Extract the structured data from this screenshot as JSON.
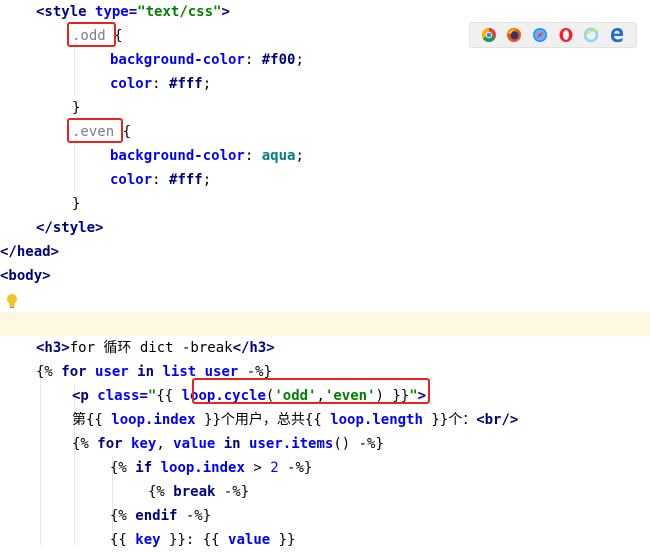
{
  "editor": {
    "lines": [
      {
        "indent": 36,
        "tokens": [
          {
            "t": "<style ",
            "c": "t-tag"
          },
          {
            "t": "type=",
            "c": "t-attr"
          },
          {
            "t": "\"text/css\"",
            "c": "t-str"
          },
          {
            "t": ">",
            "c": "t-tag"
          }
        ]
      },
      {
        "indent": 72,
        "tokens": [
          {
            "t": ".odd",
            "c": "t-sel"
          },
          {
            "t": " {",
            "c": "t-plain"
          }
        ]
      },
      {
        "indent": 110,
        "tokens": [
          {
            "t": "background-color",
            "c": "t-prop"
          },
          {
            "t": ": ",
            "c": "t-plain"
          },
          {
            "t": "#f00",
            "c": "t-val"
          },
          {
            "t": ";",
            "c": "t-plain"
          }
        ]
      },
      {
        "indent": 110,
        "tokens": [
          {
            "t": "color",
            "c": "t-prop"
          },
          {
            "t": ": ",
            "c": "t-plain"
          },
          {
            "t": "#fff",
            "c": "t-val"
          },
          {
            "t": ";",
            "c": "t-plain"
          }
        ]
      },
      {
        "indent": 72,
        "tokens": [
          {
            "t": "}",
            "c": "t-plain"
          }
        ]
      },
      {
        "indent": 72,
        "tokens": [
          {
            "t": ".even",
            "c": "t-sel"
          },
          {
            "t": " {",
            "c": "t-plain"
          }
        ]
      },
      {
        "indent": 110,
        "tokens": [
          {
            "t": "background-color",
            "c": "t-prop"
          },
          {
            "t": ": ",
            "c": "t-plain"
          },
          {
            "t": "aqua",
            "c": "t-cssval"
          },
          {
            "t": ";",
            "c": "t-plain"
          }
        ]
      },
      {
        "indent": 110,
        "tokens": [
          {
            "t": "color",
            "c": "t-prop"
          },
          {
            "t": ": ",
            "c": "t-plain"
          },
          {
            "t": "#fff",
            "c": "t-val"
          },
          {
            "t": ";",
            "c": "t-plain"
          }
        ]
      },
      {
        "indent": 72,
        "tokens": [
          {
            "t": "}",
            "c": "t-plain"
          }
        ]
      },
      {
        "indent": 36,
        "tokens": [
          {
            "t": "</style>",
            "c": "t-tag"
          }
        ]
      },
      {
        "indent": 0,
        "tokens": [
          {
            "t": "</head>",
            "c": "t-tag"
          }
        ]
      },
      {
        "indent": 0,
        "tokens": [
          {
            "t": "<body>",
            "c": "t-tag"
          }
        ]
      },
      {
        "indent": 0,
        "tokens": []
      },
      {
        "indent": 0,
        "current": true,
        "tokens": []
      },
      {
        "indent": 36,
        "tokens": [
          {
            "t": "<h3>",
            "c": "t-tag"
          },
          {
            "t": "for 循环 dict -break",
            "c": "t-text"
          },
          {
            "t": "</h3>",
            "c": "t-tag"
          }
        ]
      },
      {
        "indent": 36,
        "tokens": [
          {
            "t": "{% ",
            "c": "t-tmpl"
          },
          {
            "t": "for ",
            "c": "t-kw"
          },
          {
            "t": "user ",
            "c": "t-var"
          },
          {
            "t": "in ",
            "c": "t-kw"
          },
          {
            "t": "list_user",
            "c": "t-var"
          },
          {
            "t": " -%}",
            "c": "t-tmpl"
          }
        ]
      },
      {
        "indent": 72,
        "tokens": [
          {
            "t": "<p ",
            "c": "t-tag"
          },
          {
            "t": "class=",
            "c": "t-attr"
          },
          {
            "t": "\"",
            "c": "t-str"
          },
          {
            "t": "{{ ",
            "c": "t-tmpl"
          },
          {
            "t": "loop.cycle",
            "c": "t-var"
          },
          {
            "t": "(",
            "c": "t-plain"
          },
          {
            "t": "'odd'",
            "c": "t-str"
          },
          {
            "t": ",",
            "c": "t-plain"
          },
          {
            "t": "'even'",
            "c": "t-str"
          },
          {
            "t": ") ",
            "c": "t-plain"
          },
          {
            "t": "}}",
            "c": "t-tmpl"
          },
          {
            "t": "\"",
            "c": "t-str"
          },
          {
            "t": ">",
            "c": "t-tag"
          }
        ]
      },
      {
        "indent": 72,
        "tokens": [
          {
            "t": "第",
            "c": "t-text"
          },
          {
            "t": "{{ ",
            "c": "t-tmpl"
          },
          {
            "t": "loop.index",
            "c": "t-var"
          },
          {
            "t": " }}",
            "c": "t-tmpl"
          },
          {
            "t": "个用户，总共",
            "c": "t-text"
          },
          {
            "t": "{{ ",
            "c": "t-tmpl"
          },
          {
            "t": "loop.length",
            "c": "t-var"
          },
          {
            "t": " }}",
            "c": "t-tmpl"
          },
          {
            "t": "个：",
            "c": "t-text"
          },
          {
            "t": "<br/>",
            "c": "t-tag"
          }
        ]
      },
      {
        "indent": 72,
        "tokens": [
          {
            "t": "{% ",
            "c": "t-tmpl"
          },
          {
            "t": "for ",
            "c": "t-kw"
          },
          {
            "t": "key",
            "c": "t-var"
          },
          {
            "t": ", ",
            "c": "t-plain"
          },
          {
            "t": "value ",
            "c": "t-var"
          },
          {
            "t": "in ",
            "c": "t-kw"
          },
          {
            "t": "user.items",
            "c": "t-var"
          },
          {
            "t": "() -%}",
            "c": "t-tmpl"
          }
        ]
      },
      {
        "indent": 110,
        "tokens": [
          {
            "t": "{% ",
            "c": "t-tmpl"
          },
          {
            "t": "if ",
            "c": "t-kw"
          },
          {
            "t": "loop.index",
            "c": "t-var"
          },
          {
            "t": " > ",
            "c": "t-plain"
          },
          {
            "t": "2",
            "c": "t-num"
          },
          {
            "t": " -%}",
            "c": "t-tmpl"
          }
        ]
      },
      {
        "indent": 148,
        "tokens": [
          {
            "t": "{% ",
            "c": "t-tmpl"
          },
          {
            "t": "break",
            "c": "t-kw"
          },
          {
            "t": " -%}",
            "c": "t-tmpl"
          }
        ]
      },
      {
        "indent": 110,
        "tokens": [
          {
            "t": "{% ",
            "c": "t-tmpl"
          },
          {
            "t": "endif",
            "c": "t-kw"
          },
          {
            "t": " -%}",
            "c": "t-tmpl"
          }
        ]
      },
      {
        "indent": 110,
        "tokens": [
          {
            "t": "{{ ",
            "c": "t-tmpl"
          },
          {
            "t": "key",
            "c": "t-var"
          },
          {
            "t": " }}: ",
            "c": "t-tmpl"
          },
          {
            "t": "{{ ",
            "c": "t-tmpl"
          },
          {
            "t": "value",
            "c": "t-var"
          },
          {
            "t": " }}",
            "c": "t-tmpl"
          }
        ]
      }
    ]
  },
  "browser_icons": [
    {
      "name": "chrome-icon",
      "color": "#4285f4"
    },
    {
      "name": "firefox-icon",
      "color": "#e66000"
    },
    {
      "name": "safari-icon",
      "color": "#1e90ff"
    },
    {
      "name": "opera-icon",
      "color": "#ff1b2d"
    },
    {
      "name": "ie-icon",
      "color": "#8fd3f4"
    },
    {
      "name": "edge-icon",
      "color": "#1e6fd0"
    }
  ],
  "highlight_color": "#e5251e"
}
